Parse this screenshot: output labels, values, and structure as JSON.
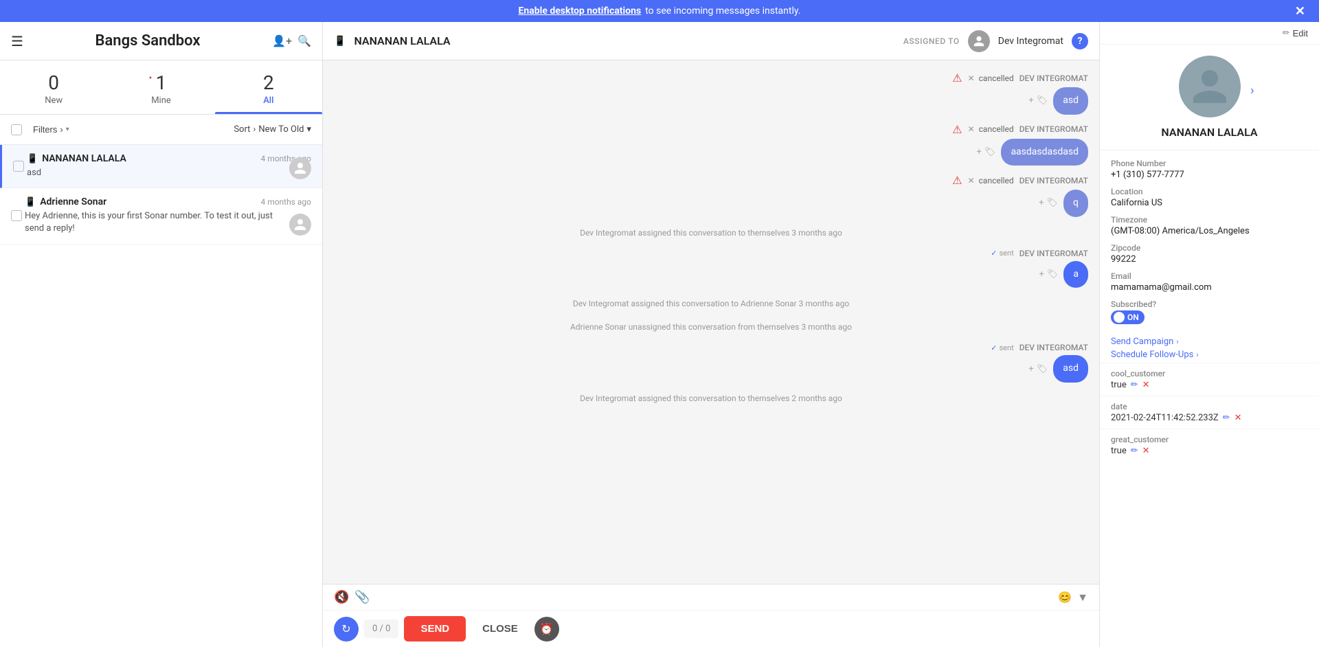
{
  "notif_bar": {
    "link_text": "Enable desktop notifications",
    "rest_text": " to see incoming messages instantly.",
    "close_label": "✕"
  },
  "sidebar": {
    "brand": "Bangs Sandbox",
    "tabs": [
      {
        "id": "new",
        "count": "0",
        "label": "New",
        "has_dot": false,
        "active": false
      },
      {
        "id": "mine",
        "count": "1",
        "label": "Mine",
        "has_dot": true,
        "active": false
      },
      {
        "id": "all",
        "count": "2",
        "label": "All",
        "has_dot": false,
        "active": true
      }
    ],
    "filters_label": "Filters",
    "sort_label": "Sort",
    "sort_value": "New To Old",
    "conversations": [
      {
        "name": "NANANAN LALALA",
        "time": "4 months ago",
        "preview": "asd",
        "active": true
      },
      {
        "name": "Adrienne Sonar",
        "time": "4 months ago",
        "preview": "Hey Adrienne, this is your first Sonar number. To test it out, just send a reply!",
        "active": false
      }
    ]
  },
  "chat": {
    "contact_name": "NANANAN LALALA",
    "assigned_to_label": "ASSIGNED TO",
    "assignee": "Dev Integromat",
    "messages": [
      {
        "type": "outbound-cancelled",
        "sender": "DEV INTEGROMAT",
        "text": "asd",
        "status": "cancelled"
      },
      {
        "type": "outbound-cancelled",
        "sender": "DEV INTEGROMAT",
        "text": "aasdasdasdasd",
        "status": "cancelled"
      },
      {
        "type": "outbound-cancelled",
        "sender": "DEV INTEGROMAT",
        "text": "q",
        "status": "cancelled"
      },
      {
        "type": "system",
        "text": "Dev Integromat assigned this conversation to themselves 3 months ago"
      },
      {
        "type": "outbound-sent",
        "sender": "DEV INTEGROMAT",
        "text": "a",
        "status": "sent"
      },
      {
        "type": "system",
        "text": "Dev Integromat assigned this conversation to Adrienne Sonar 3 months ago"
      },
      {
        "type": "system",
        "text": "Adrienne Sonar unassigned this conversation from themselves 3 months ago"
      },
      {
        "type": "outbound-sent",
        "sender": "DEV INTEGROMAT",
        "text": "asd",
        "status": "sent"
      },
      {
        "type": "system",
        "text": "Dev Integromat assigned this conversation to themselves 2 months ago"
      }
    ],
    "char_count": "0 / 0",
    "send_label": "SEND",
    "close_label": "CLOSE"
  },
  "contact_panel": {
    "edit_label": "Edit",
    "name": "NANANAN LALALA",
    "phone_label": "Phone Number",
    "phone": "+1 (310) 577-7777",
    "location_label": "Location",
    "location": "California US",
    "timezone_label": "Timezone",
    "timezone": "(GMT-08:00) America/Los_Angeles",
    "zipcode_label": "Zipcode",
    "zipcode": "99222",
    "email_label": "Email",
    "email": "mamamama@gmail.com",
    "subscribed_label": "Subscribed?",
    "subscribed_value": "ON",
    "send_campaign_label": "Send Campaign",
    "schedule_followups_label": "Schedule Follow-Ups",
    "custom_fields": [
      {
        "name": "cool_customer",
        "value": "true"
      },
      {
        "name": "date",
        "value": "2021-02-24T11:42:52.233Z"
      },
      {
        "name": "great_customer",
        "value": "true"
      }
    ]
  }
}
